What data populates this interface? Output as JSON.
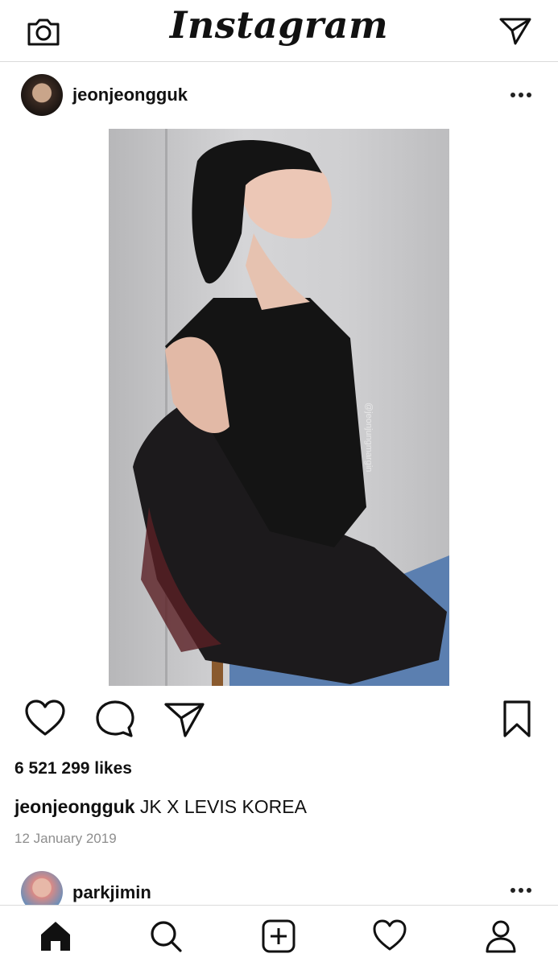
{
  "app": {
    "title": "Instagram"
  },
  "topbar": {
    "left_icon": "camera-icon",
    "right_icon": "direct-message-icon"
  },
  "post": {
    "username": "jeonjeongguk",
    "avatar_icon": "avatar",
    "likes_text": "6 521 299 likes",
    "caption_username": "jeonjeongguk",
    "caption_text": "JK X LEVIS KOREA",
    "date": "12 January 2019",
    "photo_watermark": "@jeonjungmargin",
    "actions": [
      "heart-icon",
      "comment-icon",
      "share-icon",
      "bookmark-icon"
    ]
  },
  "next_post": {
    "username": "parkjimin"
  },
  "bottom_nav": [
    "home-icon",
    "search-icon",
    "add-post-icon",
    "activity-heart-icon",
    "profile-icon"
  ],
  "colors": {
    "background": "#ffffff",
    "text": "#111111",
    "muted": "#8e8e8e",
    "divider": "#dbdbdb"
  }
}
